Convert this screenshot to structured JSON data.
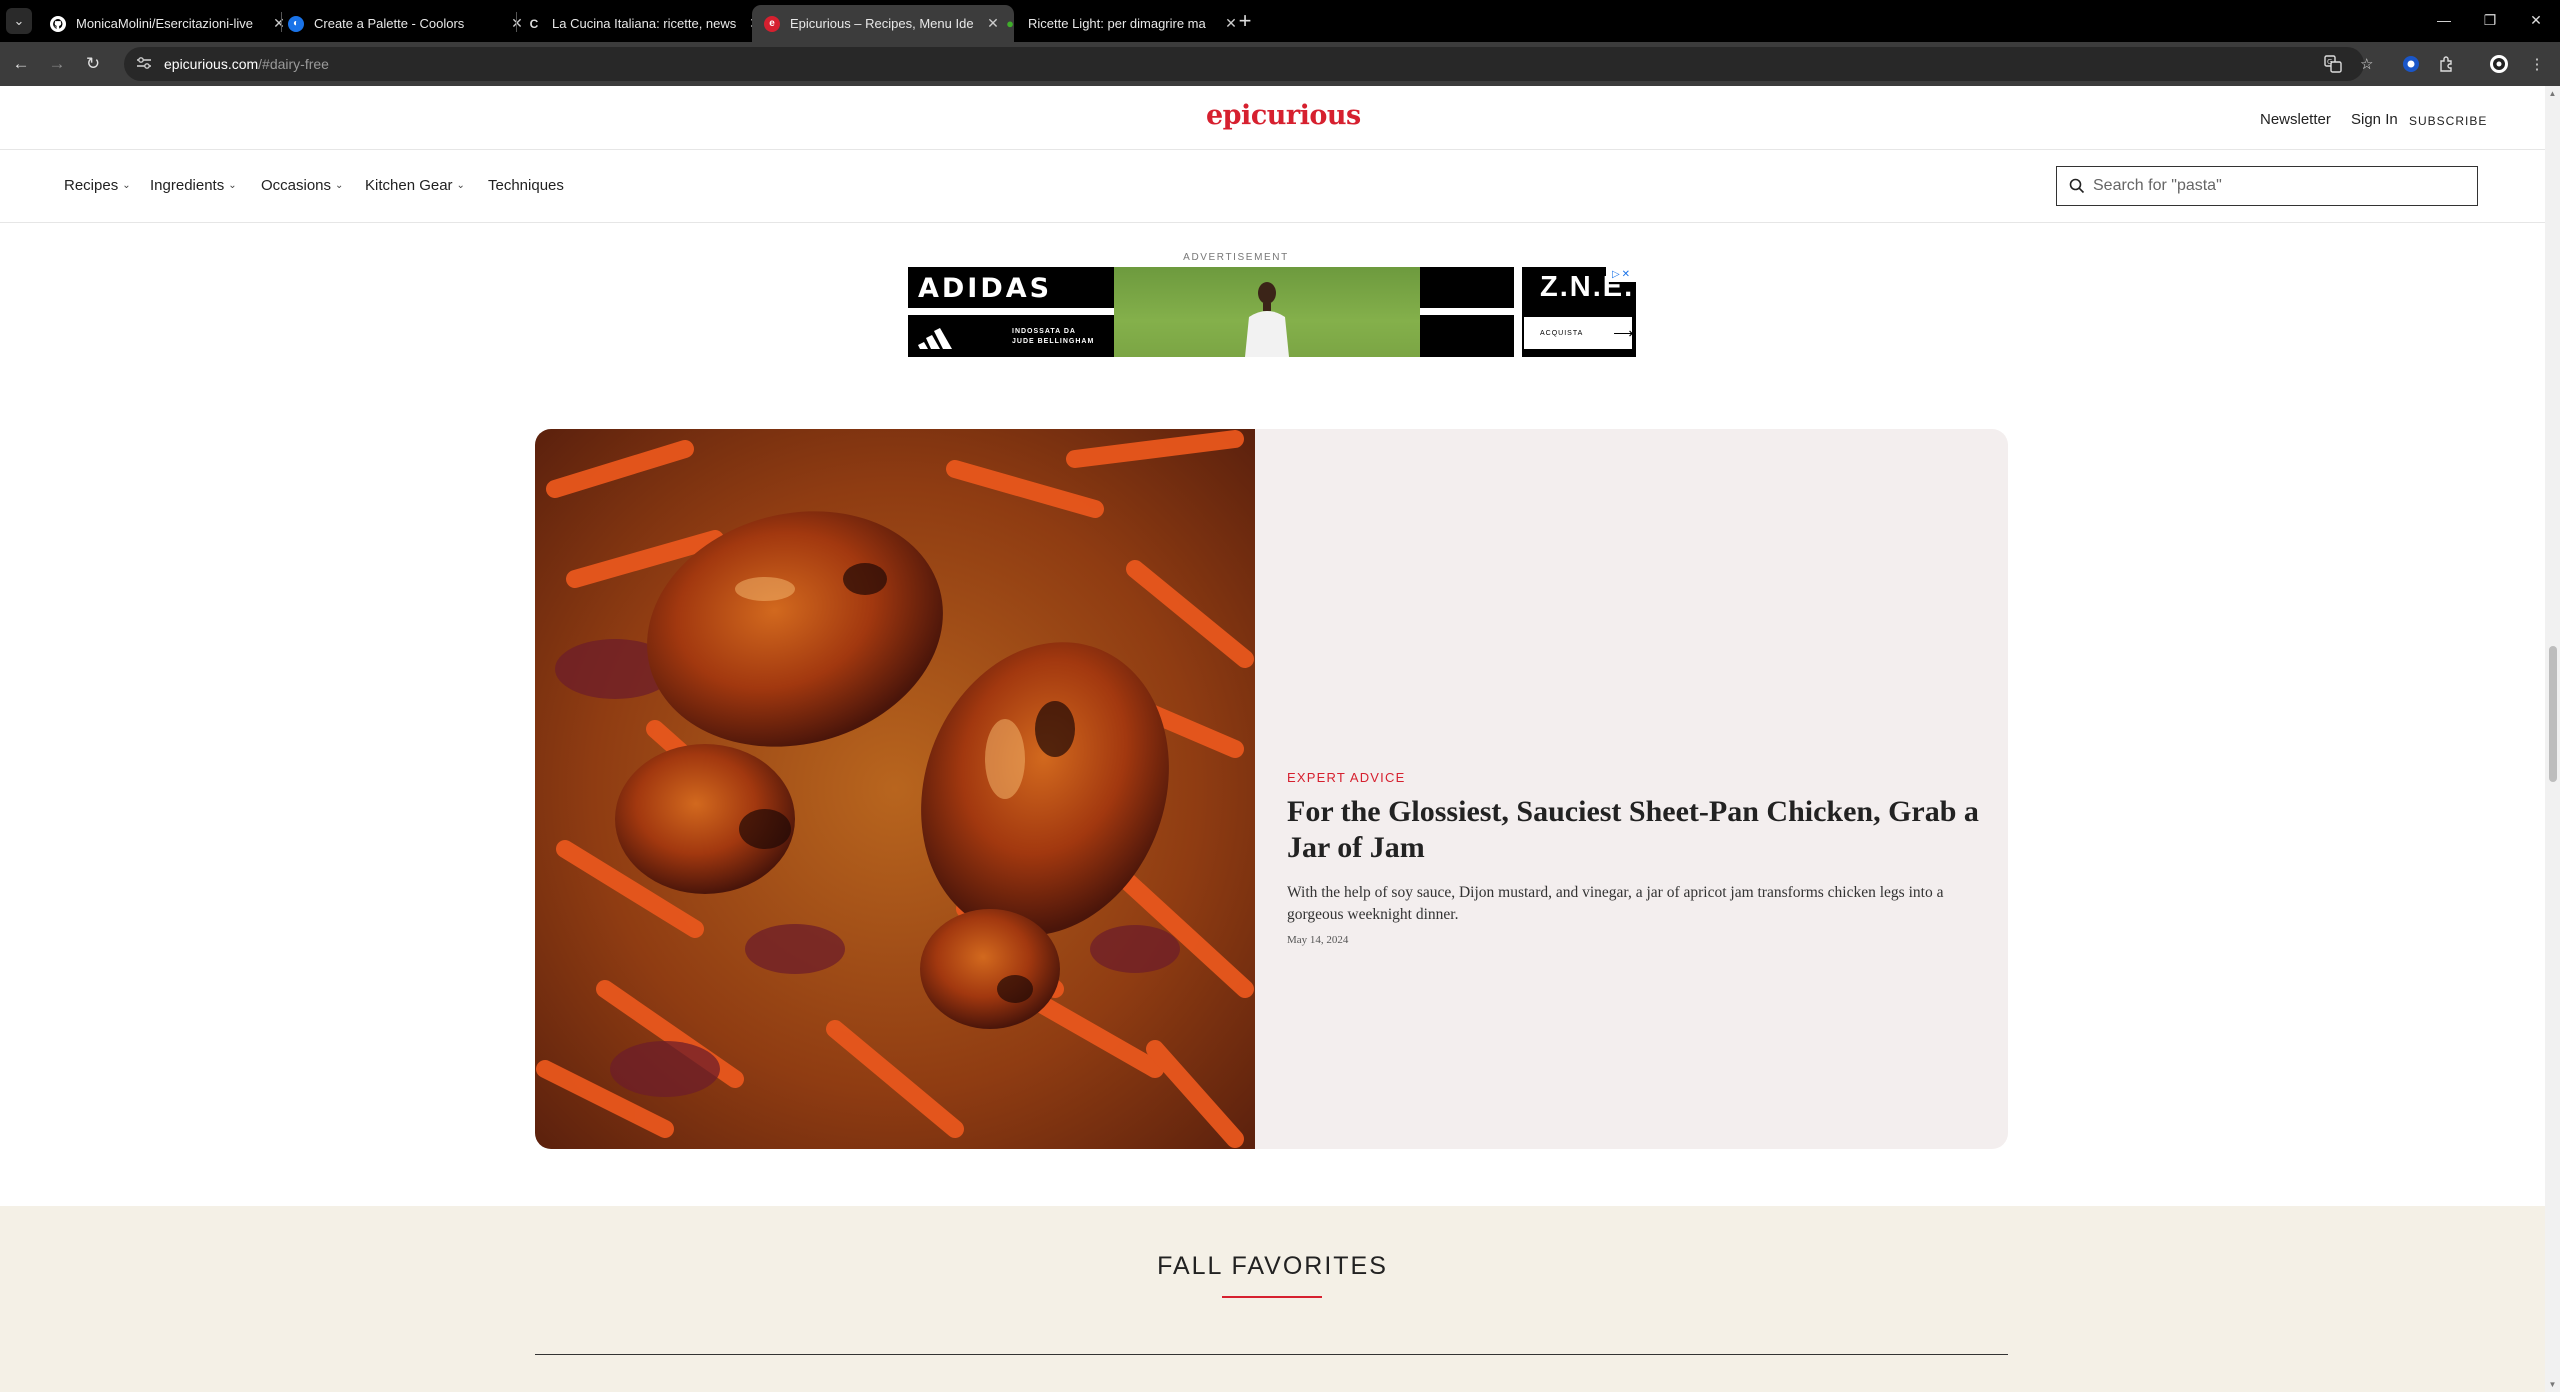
{
  "browser": {
    "tabs": [
      {
        "title": "MonicaMolini/Esercitazioni-live",
        "favicon": "github-icon",
        "active": false
      },
      {
        "title": "Create a Palette - Coolors",
        "favicon": "coolors-icon",
        "active": false
      },
      {
        "title": "La Cucina Italiana: ricette, news",
        "favicon": "lacucina-icon",
        "active": false
      },
      {
        "title": "Epicurious – Recipes, Menu Ide",
        "favicon": "epicurious-icon",
        "active": true
      },
      {
        "title": "Ricette Light: per dimagrire ma",
        "favicon": "leaf-icon",
        "active": false
      }
    ],
    "url_host": "epicurious.com",
    "url_path": "/#dairy-free"
  },
  "site": {
    "logo": "epicurious",
    "header_links": {
      "newsletter": "Newsletter",
      "sign_in": "Sign In",
      "subscribe": "SUBSCRIBE"
    },
    "nav": [
      {
        "label": "Recipes",
        "dropdown": true
      },
      {
        "label": "Ingredients",
        "dropdown": true
      },
      {
        "label": "Occasions",
        "dropdown": true
      },
      {
        "label": "Kitchen Gear",
        "dropdown": true
      },
      {
        "label": "Techniques",
        "dropdown": false
      }
    ],
    "search_placeholder": "Search for \"pasta\""
  },
  "ad": {
    "label": "ADVERTISEMENT",
    "brand": "ADIDAS",
    "tagline_line1": "INDOSSATA DA",
    "tagline_line2": "JUDE BELLINGHAM",
    "side_brand": "Z.N.E.",
    "cta": "ACQUISTA"
  },
  "feature": {
    "kicker": "EXPERT ADVICE",
    "headline": "For the Glossiest, Sauciest Sheet-Pan Chicken, Grab a Jar of Jam",
    "dek": "With the help of soy sauce, Dijon mustard, and vinegar, a jar of apricot jam transforms chicken legs into a gorgeous weeknight dinner.",
    "date": "May 14, 2024"
  },
  "section": {
    "title": "FALL FAVORITES"
  },
  "colors": {
    "brand_red": "#d6202f",
    "feature_bg": "#f3eeee",
    "section_bg": "#f4f0e6"
  }
}
